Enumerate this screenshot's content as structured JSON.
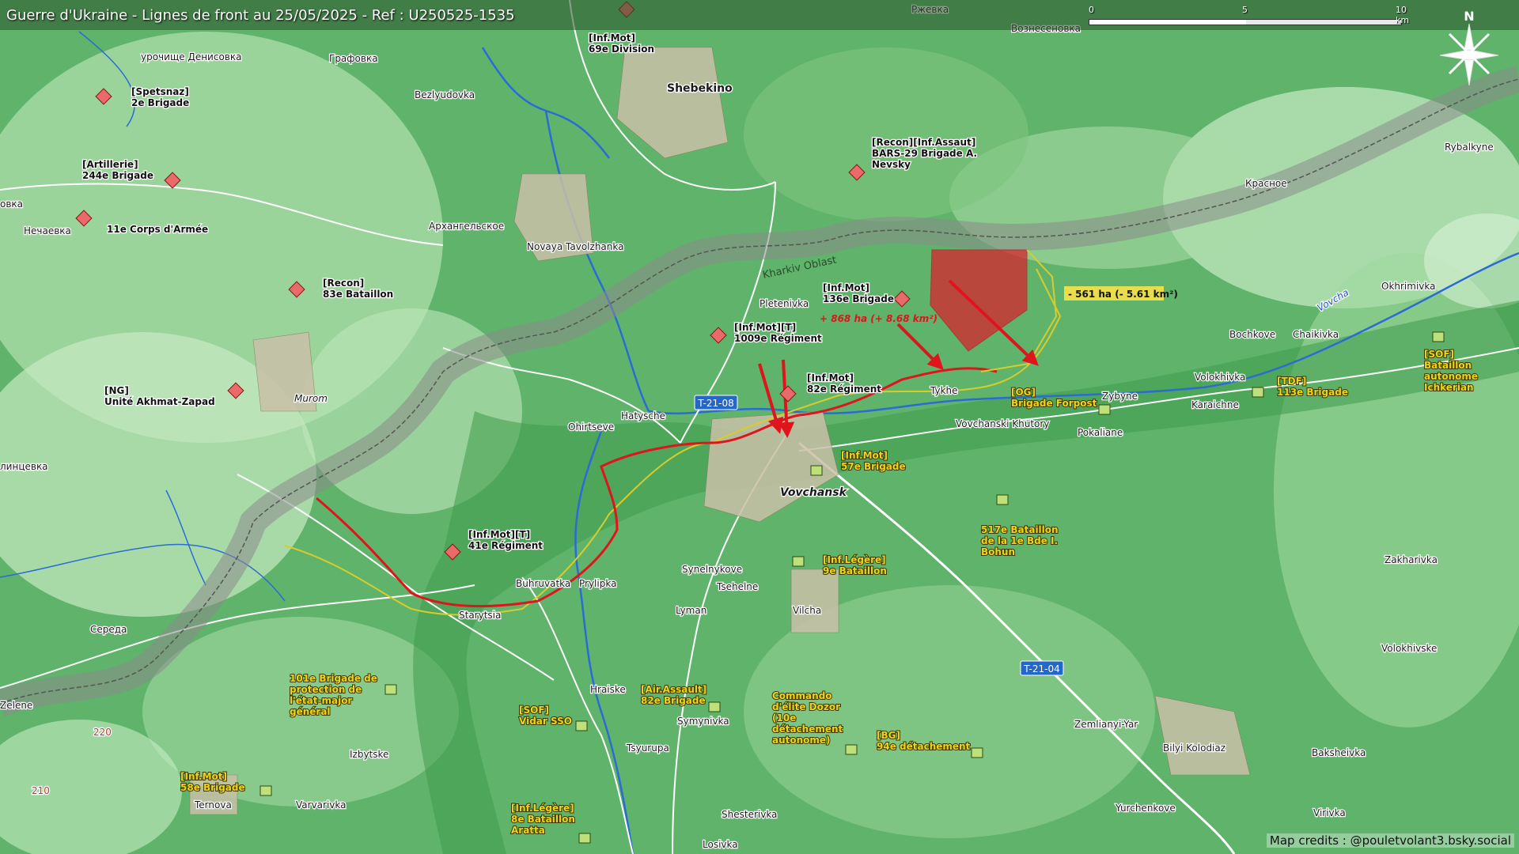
{
  "title": "Guerre d'Ukraine - Lignes de front au 25/05/2025 - Ref : U250525-1535",
  "scale": {
    "labels": [
      "0",
      "5",
      "10 km"
    ]
  },
  "compass": {
    "label": "N"
  },
  "credits": "Map credits : @pouletvolant3.bsky.social",
  "region_label": "Kharkiv Oblast",
  "stats": {
    "gain": "+ 868 ha (+ 8.68 km²)",
    "loss": "- 561 ha (- 5.61 km²)"
  },
  "colors": {
    "russian": "#d9232d",
    "ukrainian": "#c8d44a",
    "frontline": "#e0141c",
    "border": "#808080",
    "terrain": "#5fb36a"
  },
  "places": [
    {
      "id": "shebekino",
      "text": "Shebekino"
    },
    {
      "id": "bezlyudovka",
      "text": "Bezlyudovka"
    },
    {
      "id": "novaya-tavolzhanka",
      "text": "Novaya Tavolzhanka"
    },
    {
      "id": "arkhangelskoe",
      "text": "Архангельское"
    },
    {
      "id": "grafovka",
      "text": "Графовка"
    },
    {
      "id": "urochishche",
      "text": "урочище Денисовка"
    },
    {
      "id": "nechaevka",
      "text": "Нечаевка"
    },
    {
      "id": "murom",
      "text": "Murom"
    },
    {
      "id": "pletenivka",
      "text": "Pletenivka"
    },
    {
      "id": "hatysche",
      "text": "Hatysche"
    },
    {
      "id": "ohirtseve",
      "text": "Ohirtseve"
    },
    {
      "id": "vovchansk",
      "text": "Vovchansk"
    },
    {
      "id": "tykhe",
      "text": "Tykhe"
    },
    {
      "id": "vovchanski-khutory",
      "text": "Vovchanski Khutory"
    },
    {
      "id": "zybyne",
      "text": "Zybyne"
    },
    {
      "id": "pokaliane",
      "text": "Pokaliane"
    },
    {
      "id": "volokhivka",
      "text": "Volokhivka"
    },
    {
      "id": "karaichne",
      "text": "Karaichne"
    },
    {
      "id": "bochkove",
      "text": "Bochkove"
    },
    {
      "id": "chaikivka",
      "text": "Chaikivka"
    },
    {
      "id": "okhrimivka",
      "text": "Okhrimivka"
    },
    {
      "id": "rybalkyne",
      "text": "Rybalkyne"
    },
    {
      "id": "krasnoe",
      "text": "Красное"
    },
    {
      "id": "vozn",
      "text": "Вознесеновка"
    },
    {
      "id": "rzhevka",
      "text": "Ржевка"
    },
    {
      "id": "starytsia",
      "text": "Starytsia"
    },
    {
      "id": "buhruvatka",
      "text": "Buhruvatka"
    },
    {
      "id": "prylipka",
      "text": "Prylipka"
    },
    {
      "id": "synelnykove",
      "text": "Synelnykove"
    },
    {
      "id": "tsehelne",
      "text": "Tsehelne"
    },
    {
      "id": "lyman",
      "text": "Lyman"
    },
    {
      "id": "vilcha",
      "text": "Vilcha"
    },
    {
      "id": "hraiske",
      "text": "Hraiske"
    },
    {
      "id": "symynivka",
      "text": "Symynivka"
    },
    {
      "id": "tsyurupa",
      "text": "Tsyurupa"
    },
    {
      "id": "izbytske",
      "text": "Izbytske"
    },
    {
      "id": "varvarivka",
      "text": "Varvarivka"
    },
    {
      "id": "ternova",
      "text": "Ternova"
    },
    {
      "id": "sereda",
      "text": "Середа"
    },
    {
      "id": "zelene",
      "text": "Zelene"
    },
    {
      "id": "shestерivka",
      "text": "Shesterivka"
    },
    {
      "id": "losivka",
      "text": "Losivka"
    },
    {
      "id": "yurchenkove",
      "text": "Yurchenkove"
    },
    {
      "id": "bilyi-kolodiaz",
      "text": "Bilyi Kolodiaz"
    },
    {
      "id": "zemlianyi-yar",
      "text": "Zemlianyi-Yar"
    },
    {
      "id": "baksheivka",
      "text": "Baksheivka"
    },
    {
      "id": "virivka",
      "text": "Virivka"
    },
    {
      "id": "volokhivske",
      "text": "Volokhivske"
    },
    {
      "id": "zakharivka",
      "text": "Zakharivka"
    },
    {
      "id": "vovcha",
      "text": "Vovcha"
    },
    {
      "id": "ovka",
      "text": "овка"
    },
    {
      "id": "lnitsevka",
      "text": "линцевка"
    },
    {
      "id": "r220",
      "text": "220"
    },
    {
      "id": "r210",
      "text": "210"
    }
  ],
  "roads": [
    {
      "id": "t2108",
      "text": "T-21-08"
    },
    {
      "id": "t2104",
      "text": "T-21-04"
    }
  ],
  "russian_units": [
    {
      "lines": [
        "[Inf.Mot]",
        "69e Division"
      ]
    },
    {
      "lines": [
        "[Spetsnaz]",
        "2e Brigade"
      ]
    },
    {
      "lines": [
        "[Artillerie]",
        "244e Brigade"
      ]
    },
    {
      "lines": [
        "11e Corps d'Armée"
      ]
    },
    {
      "lines": [
        "[Recon]",
        "83e Bataillon"
      ]
    },
    {
      "lines": [
        "[NG]",
        "Unité Akhmat-Zapad"
      ]
    },
    {
      "lines": [
        "[Recon][Inf.Assaut]",
        "BARS-29 Brigade A.",
        "Nevsky"
      ]
    },
    {
      "lines": [
        "[Inf.Mot]",
        "136e Brigade"
      ]
    },
    {
      "lines": [
        "[Inf.Mot][T]",
        "1009e Régiment"
      ]
    },
    {
      "lines": [
        "[Inf.Mot]",
        "82e Régiment"
      ]
    },
    {
      "lines": [
        "[Inf.Mot][T]",
        "41e Régiment"
      ]
    }
  ],
  "ukrainian_units": [
    {
      "lines": [
        "[Inf.Mot]",
        "57e Brigade"
      ]
    },
    {
      "lines": [
        "[OG]",
        "Brigade Forpost"
      ]
    },
    {
      "lines": [
        "[TDF]",
        "113e Brigade"
      ]
    },
    {
      "lines": [
        "[SOF]",
        "Bataillon",
        "autonome",
        "Ichkerian"
      ]
    },
    {
      "lines": [
        "517e Bataillon",
        "de la 1e Bde I.",
        "Bohun"
      ]
    },
    {
      "lines": [
        "[Inf.Légère]",
        "9e Bataillon"
      ]
    },
    {
      "lines": [
        "101e Brigade de",
        "protection de",
        "l'état-major",
        "général"
      ]
    },
    {
      "lines": [
        "[SOF]",
        "Vidar SSO"
      ]
    },
    {
      "lines": [
        "[Air.Assault]",
        "82e Brigade"
      ]
    },
    {
      "lines": [
        "Commando",
        "d'élite Dozor",
        "(10e",
        "détachement",
        "autonome)"
      ]
    },
    {
      "lines": [
        "[BG]",
        "94e détachement"
      ]
    },
    {
      "lines": [
        "[Inf.Mot]",
        "58e Brigade"
      ]
    },
    {
      "lines": [
        "[Inf.Légère]",
        "8e Bataillon",
        "Aratta"
      ]
    }
  ]
}
